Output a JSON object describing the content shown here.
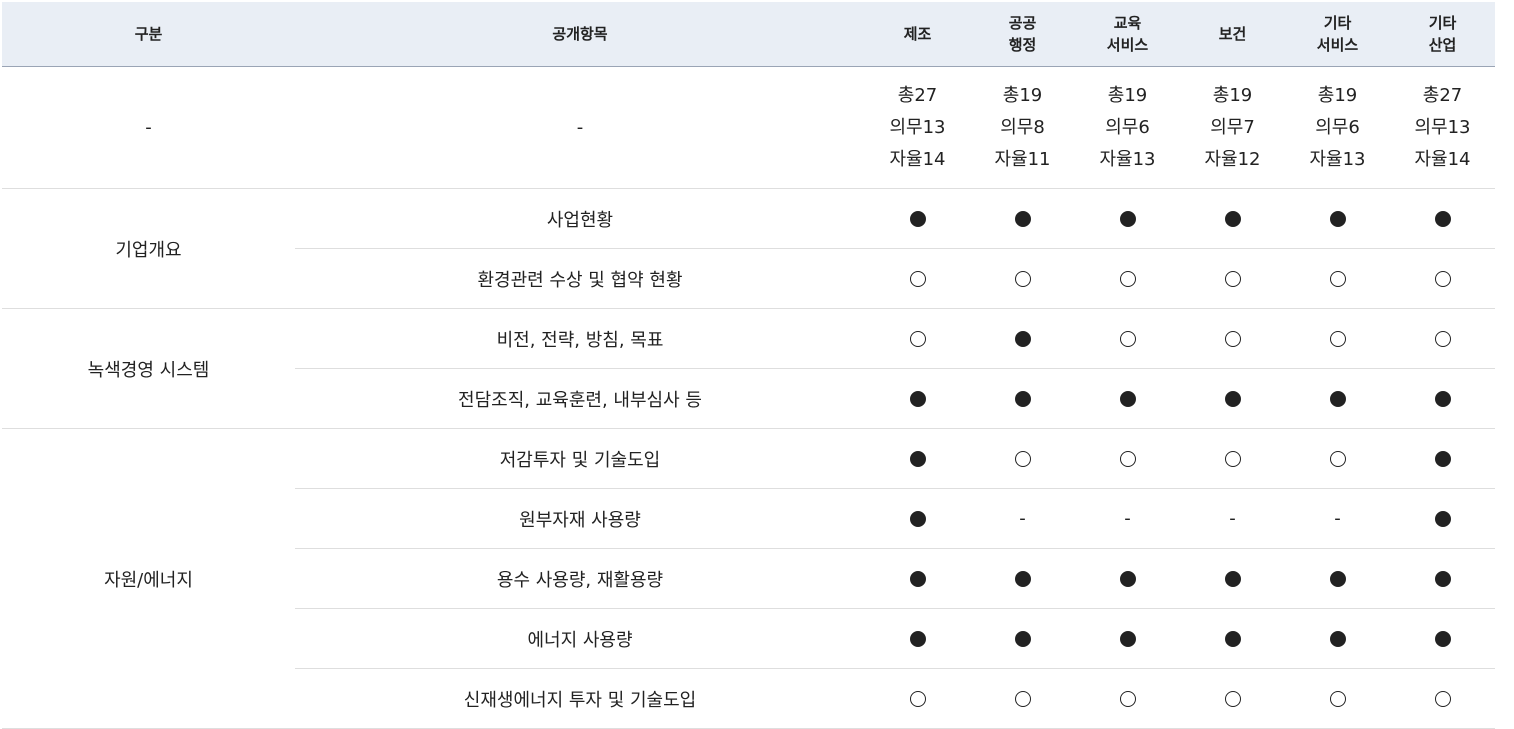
{
  "header": {
    "category": "구분",
    "item": "공개항목",
    "industries": [
      [
        "제조"
      ],
      [
        "공공",
        "행정"
      ],
      [
        "교육",
        "서비스"
      ],
      [
        "보건"
      ],
      [
        "기타",
        "서비스"
      ],
      [
        "기타",
        "산업"
      ]
    ]
  },
  "summary": {
    "category": "-",
    "item": "-",
    "cells": [
      [
        "총27",
        "의무13",
        "자율14"
      ],
      [
        "총19",
        "의무8",
        "자율11"
      ],
      [
        "총19",
        "의무6",
        "자율13"
      ],
      [
        "총19",
        "의무7",
        "자율12"
      ],
      [
        "총19",
        "의무6",
        "자율13"
      ],
      [
        "총27",
        "의무13",
        "자율14"
      ]
    ]
  },
  "groups": [
    {
      "name": "기업개요",
      "rows": [
        {
          "item": "사업현황",
          "marks": [
            "full",
            "full",
            "full",
            "full",
            "full",
            "full"
          ]
        },
        {
          "item": "환경관련 수상 및 협약 현황",
          "marks": [
            "empty",
            "empty",
            "empty",
            "empty",
            "empty",
            "empty"
          ]
        }
      ]
    },
    {
      "name": "녹색경영 시스템",
      "rows": [
        {
          "item": "비전, 전략, 방침, 목표",
          "marks": [
            "empty",
            "full",
            "empty",
            "empty",
            "empty",
            "empty"
          ]
        },
        {
          "item": "전담조직, 교육훈련, 내부심사 등",
          "marks": [
            "full",
            "full",
            "full",
            "full",
            "full",
            "full"
          ]
        }
      ]
    },
    {
      "name": "자원/에너지",
      "rows": [
        {
          "item": "저감투자 및 기술도입",
          "marks": [
            "full",
            "empty",
            "empty",
            "empty",
            "empty",
            "full"
          ]
        },
        {
          "item": "원부자재 사용량",
          "marks": [
            "full",
            "-",
            "-",
            "-",
            "-",
            "full"
          ]
        },
        {
          "item": "용수 사용량, 재활용량",
          "marks": [
            "full",
            "full",
            "full",
            "full",
            "full",
            "full"
          ]
        },
        {
          "item": "에너지 사용량",
          "marks": [
            "full",
            "full",
            "full",
            "full",
            "full",
            "full"
          ]
        },
        {
          "item": "신재생에너지 투자 및 기술도입",
          "marks": [
            "empty",
            "empty",
            "empty",
            "empty",
            "empty",
            "empty"
          ]
        }
      ]
    }
  ]
}
